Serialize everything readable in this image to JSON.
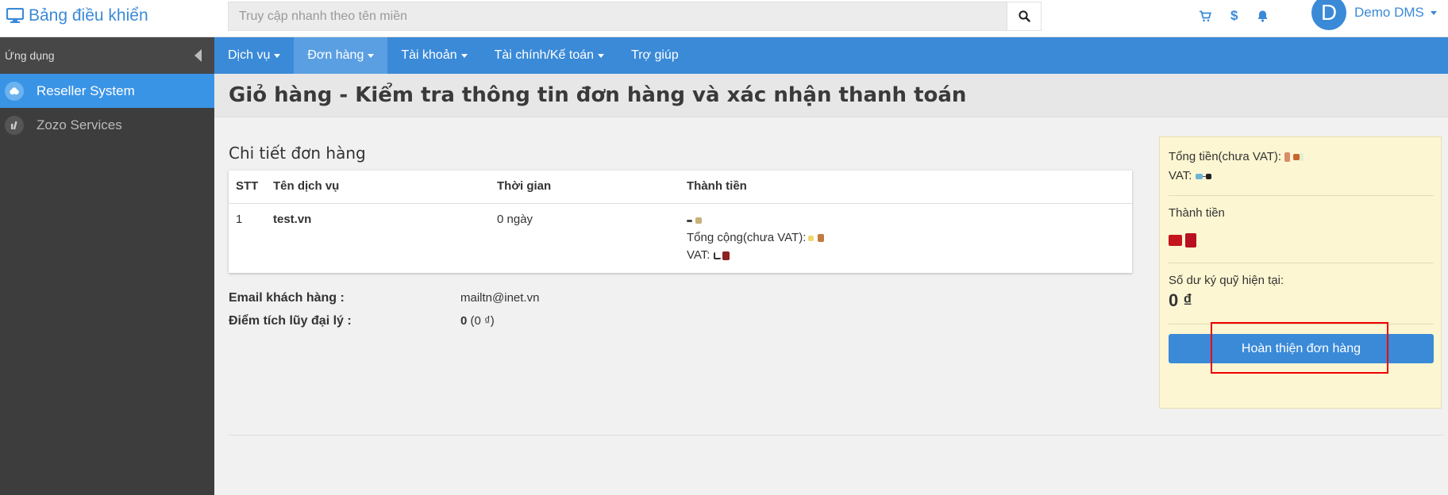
{
  "header": {
    "brand": "Bảng điều khiển",
    "search_placeholder": "Truy cập nhanh theo tên miền",
    "avatar_letter": "D",
    "user_name": "Demo DMS"
  },
  "sidebar": {
    "heading": "Ứng dụng",
    "items": [
      {
        "label": "Reseller System"
      },
      {
        "label": "Zozo Services"
      }
    ]
  },
  "nav": {
    "items": [
      {
        "label": "Dịch vụ"
      },
      {
        "label": "Đơn hàng"
      },
      {
        "label": "Tài khoản"
      },
      {
        "label": "Tài chính/Kế toán"
      },
      {
        "label": "Trợ giúp"
      }
    ]
  },
  "page": {
    "title": "Giỏ hàng - Kiểm tra thông tin đơn hàng và xác nhận thanh toán",
    "section_title": "Chi tiết đơn hàng"
  },
  "table": {
    "columns": [
      "STT",
      "Tên dịch vụ",
      "Thời gian",
      "Thành tiền"
    ],
    "rows": [
      {
        "stt": "1",
        "service": "test.vn",
        "duration": "0 ngày",
        "subtotal_label": "Tổng cộng(chưa VAT):",
        "vat_label": "VAT:"
      }
    ]
  },
  "customer": {
    "email_label": "Email khách hàng :",
    "email_value": "mailtn@inet.vn",
    "points_label": "Điểm tích lũy đại lý :",
    "points_value": "0",
    "points_money": "(0 ₫)"
  },
  "summary": {
    "total_label": "Tổng tiền(chưa VAT):",
    "vat_label": "VAT:",
    "grand_total_label": "Thành tiền",
    "balance_label": "Số dư ký quỹ hiện tại:",
    "balance_value": "0 ₫",
    "complete_button": "Hoàn thiện đơn hàng"
  },
  "colors": {
    "accent": "#3a8ad8",
    "sidebar_bg": "#3d3d3d",
    "sidebar_active": "#3a94e6",
    "summary_bg": "#fdf6d2",
    "highlight": "#ee0000"
  }
}
